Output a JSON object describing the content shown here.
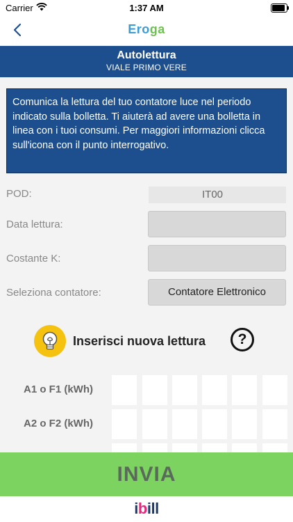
{
  "status_bar": {
    "carrier": "Carrier",
    "time": "1:37 AM"
  },
  "nav": {
    "logo_part1": "Ero",
    "logo_part2": "ga",
    "back_icon": "chevron-left-icon"
  },
  "header": {
    "title": "Autolettura",
    "subtitle": "VIALE PRIMO VERE"
  },
  "info": {
    "text": "Comunica la lettura del tuo contatore luce nel periodo indicato sulla bolletta. Ti aiuterà ad avere una bolletta in linea con i tuoi consumi. Per maggiori informazioni clicca sull'icona con il punto interrogativo."
  },
  "form": {
    "pod_label": "POD:",
    "pod_value": "IT00",
    "data_lettura_label": "Data lettura:",
    "data_lettura_value": "",
    "costante_label": "Costante K:",
    "costante_value": "",
    "contatore_label": "Seleziona contatore:",
    "contatore_value": "Contatore Elettronico"
  },
  "new_reading": {
    "label": "Inserisci nuova lettura",
    "help": "?"
  },
  "readings": [
    {
      "label": "A1 o F1 (kWh)"
    },
    {
      "label": "A2 o F2 (kWh)"
    }
  ],
  "actions": {
    "send_label": "INVIA"
  },
  "footer": {
    "brand_i": "i",
    "brand_b": "b",
    "brand_rest": "ill"
  },
  "colors": {
    "primary": "#1d4f8e",
    "accent_green": "#7dd360",
    "bulb_yellow": "#f4c20f"
  }
}
